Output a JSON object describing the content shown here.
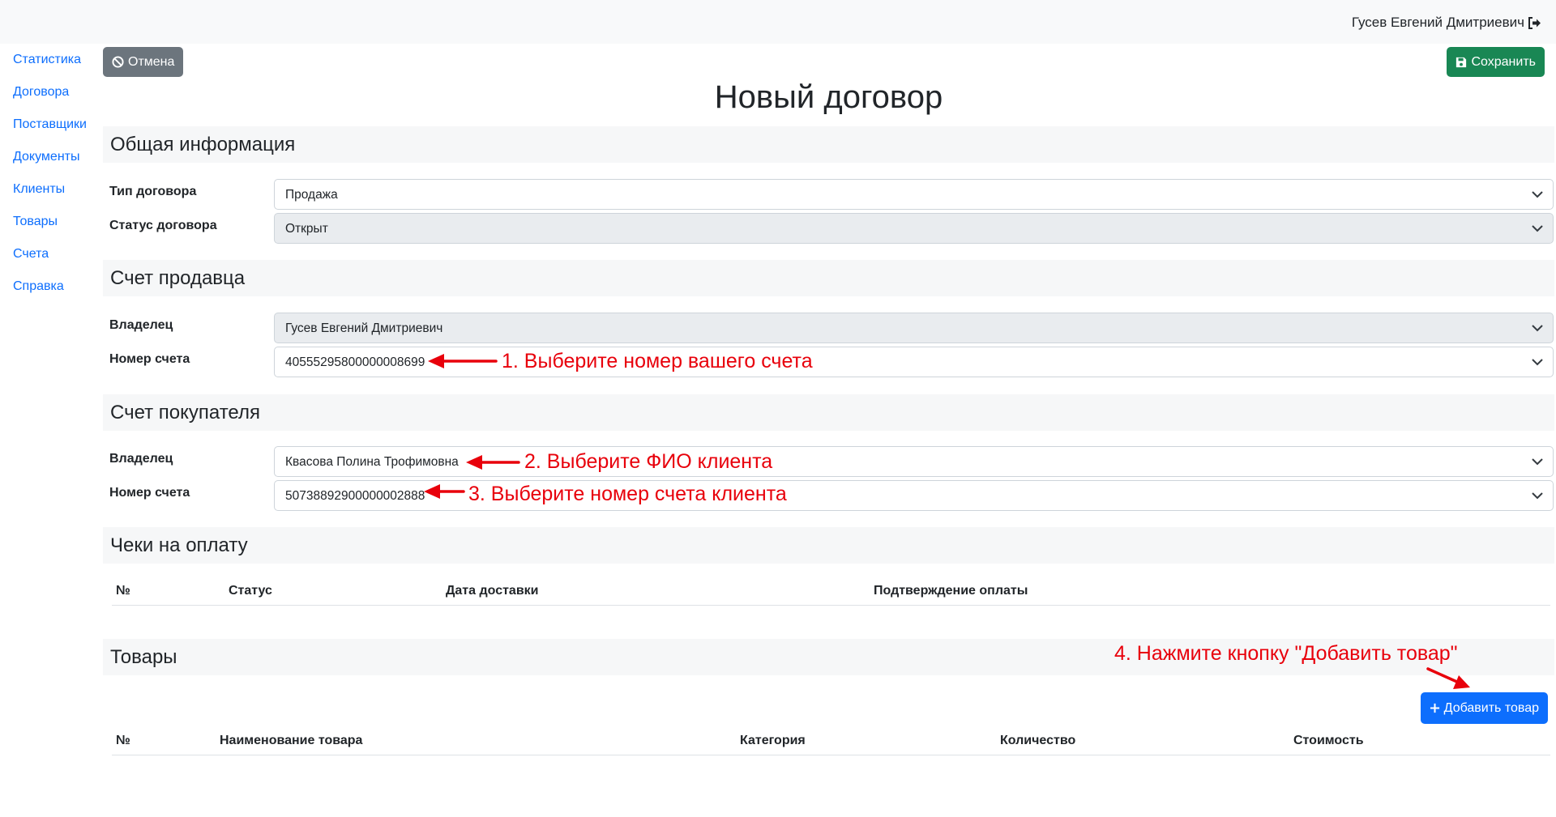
{
  "header": {
    "user_name": "Гусев Евгений Дмитриевич"
  },
  "sidebar": {
    "items": [
      {
        "label": "Статистика"
      },
      {
        "label": "Договора"
      },
      {
        "label": "Поставщики"
      },
      {
        "label": "Документы"
      },
      {
        "label": "Клиенты"
      },
      {
        "label": "Товары"
      },
      {
        "label": "Счета"
      },
      {
        "label": "Справка"
      }
    ]
  },
  "toolbar": {
    "cancel_label": "Отмена",
    "save_label": "Сохранить"
  },
  "page": {
    "title": "Новый договор"
  },
  "general": {
    "heading": "Общая информация",
    "type_label": "Тип договора",
    "type_value": "Продажа",
    "status_label": "Статус договора",
    "status_value": "Открыт"
  },
  "seller": {
    "heading": "Счет продавца",
    "owner_label": "Владелец",
    "owner_value": "Гусев Евгений Дмитриевич",
    "account_label": "Номер счета",
    "account_value": "40555295800000008699"
  },
  "buyer": {
    "heading": "Счет покупателя",
    "owner_label": "Владелец",
    "owner_value": "Квасова Полина Трофимовна",
    "account_label": "Номер счета",
    "account_value": "50738892900000002888"
  },
  "checks": {
    "heading": "Чеки на оплату",
    "columns": [
      "№",
      "Статус",
      "Дата доставки",
      "Подтверждение оплаты"
    ]
  },
  "goods": {
    "heading": "Товары",
    "add_label": "Добавить товар",
    "columns": [
      "№",
      "Наименование товара",
      "Категория",
      "Количество",
      "Стоимость"
    ]
  },
  "annotations": {
    "note1": "1. Выберите номер вашего счета",
    "note2": "2. Выберите ФИО клиента",
    "note3": "3. Выберите номер счета клиента",
    "note4": "4. Нажмите кнопку \"Добавить товар\""
  },
  "colors": {
    "accent": "#0d6efd",
    "success": "#198754",
    "secondary": "#6c757d",
    "annotation": "#e8000b"
  },
  "icons": {
    "user_logout": "sign-out-icon",
    "cancel": "ban-icon",
    "save": "floppy-disk-icon",
    "add": "plus-icon",
    "select": "chevron-down-icon"
  }
}
